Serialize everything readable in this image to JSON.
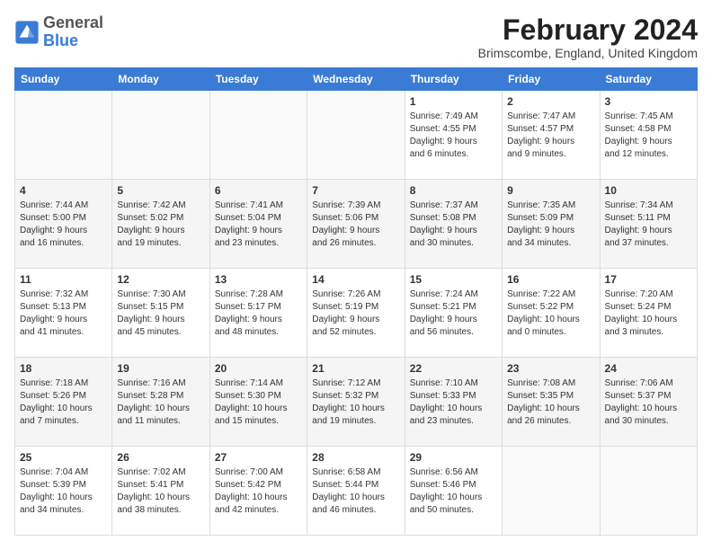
{
  "header": {
    "logo_general": "General",
    "logo_blue": "Blue",
    "month_year": "February 2024",
    "location": "Brimscombe, England, United Kingdom"
  },
  "days_of_week": [
    "Sunday",
    "Monday",
    "Tuesday",
    "Wednesday",
    "Thursday",
    "Friday",
    "Saturday"
  ],
  "weeks": [
    [
      {
        "day": "",
        "info": ""
      },
      {
        "day": "",
        "info": ""
      },
      {
        "day": "",
        "info": ""
      },
      {
        "day": "",
        "info": ""
      },
      {
        "day": "1",
        "info": "Sunrise: 7:49 AM\nSunset: 4:55 PM\nDaylight: 9 hours\nand 6 minutes."
      },
      {
        "day": "2",
        "info": "Sunrise: 7:47 AM\nSunset: 4:57 PM\nDaylight: 9 hours\nand 9 minutes."
      },
      {
        "day": "3",
        "info": "Sunrise: 7:45 AM\nSunset: 4:58 PM\nDaylight: 9 hours\nand 12 minutes."
      }
    ],
    [
      {
        "day": "4",
        "info": "Sunrise: 7:44 AM\nSunset: 5:00 PM\nDaylight: 9 hours\nand 16 minutes."
      },
      {
        "day": "5",
        "info": "Sunrise: 7:42 AM\nSunset: 5:02 PM\nDaylight: 9 hours\nand 19 minutes."
      },
      {
        "day": "6",
        "info": "Sunrise: 7:41 AM\nSunset: 5:04 PM\nDaylight: 9 hours\nand 23 minutes."
      },
      {
        "day": "7",
        "info": "Sunrise: 7:39 AM\nSunset: 5:06 PM\nDaylight: 9 hours\nand 26 minutes."
      },
      {
        "day": "8",
        "info": "Sunrise: 7:37 AM\nSunset: 5:08 PM\nDaylight: 9 hours\nand 30 minutes."
      },
      {
        "day": "9",
        "info": "Sunrise: 7:35 AM\nSunset: 5:09 PM\nDaylight: 9 hours\nand 34 minutes."
      },
      {
        "day": "10",
        "info": "Sunrise: 7:34 AM\nSunset: 5:11 PM\nDaylight: 9 hours\nand 37 minutes."
      }
    ],
    [
      {
        "day": "11",
        "info": "Sunrise: 7:32 AM\nSunset: 5:13 PM\nDaylight: 9 hours\nand 41 minutes."
      },
      {
        "day": "12",
        "info": "Sunrise: 7:30 AM\nSunset: 5:15 PM\nDaylight: 9 hours\nand 45 minutes."
      },
      {
        "day": "13",
        "info": "Sunrise: 7:28 AM\nSunset: 5:17 PM\nDaylight: 9 hours\nand 48 minutes."
      },
      {
        "day": "14",
        "info": "Sunrise: 7:26 AM\nSunset: 5:19 PM\nDaylight: 9 hours\nand 52 minutes."
      },
      {
        "day": "15",
        "info": "Sunrise: 7:24 AM\nSunset: 5:21 PM\nDaylight: 9 hours\nand 56 minutes."
      },
      {
        "day": "16",
        "info": "Sunrise: 7:22 AM\nSunset: 5:22 PM\nDaylight: 10 hours\nand 0 minutes."
      },
      {
        "day": "17",
        "info": "Sunrise: 7:20 AM\nSunset: 5:24 PM\nDaylight: 10 hours\nand 3 minutes."
      }
    ],
    [
      {
        "day": "18",
        "info": "Sunrise: 7:18 AM\nSunset: 5:26 PM\nDaylight: 10 hours\nand 7 minutes."
      },
      {
        "day": "19",
        "info": "Sunrise: 7:16 AM\nSunset: 5:28 PM\nDaylight: 10 hours\nand 11 minutes."
      },
      {
        "day": "20",
        "info": "Sunrise: 7:14 AM\nSunset: 5:30 PM\nDaylight: 10 hours\nand 15 minutes."
      },
      {
        "day": "21",
        "info": "Sunrise: 7:12 AM\nSunset: 5:32 PM\nDaylight: 10 hours\nand 19 minutes."
      },
      {
        "day": "22",
        "info": "Sunrise: 7:10 AM\nSunset: 5:33 PM\nDaylight: 10 hours\nand 23 minutes."
      },
      {
        "day": "23",
        "info": "Sunrise: 7:08 AM\nSunset: 5:35 PM\nDaylight: 10 hours\nand 26 minutes."
      },
      {
        "day": "24",
        "info": "Sunrise: 7:06 AM\nSunset: 5:37 PM\nDaylight: 10 hours\nand 30 minutes."
      }
    ],
    [
      {
        "day": "25",
        "info": "Sunrise: 7:04 AM\nSunset: 5:39 PM\nDaylight: 10 hours\nand 34 minutes."
      },
      {
        "day": "26",
        "info": "Sunrise: 7:02 AM\nSunset: 5:41 PM\nDaylight: 10 hours\nand 38 minutes."
      },
      {
        "day": "27",
        "info": "Sunrise: 7:00 AM\nSunset: 5:42 PM\nDaylight: 10 hours\nand 42 minutes."
      },
      {
        "day": "28",
        "info": "Sunrise: 6:58 AM\nSunset: 5:44 PM\nDaylight: 10 hours\nand 46 minutes."
      },
      {
        "day": "29",
        "info": "Sunrise: 6:56 AM\nSunset: 5:46 PM\nDaylight: 10 hours\nand 50 minutes."
      },
      {
        "day": "",
        "info": ""
      },
      {
        "day": "",
        "info": ""
      }
    ]
  ]
}
